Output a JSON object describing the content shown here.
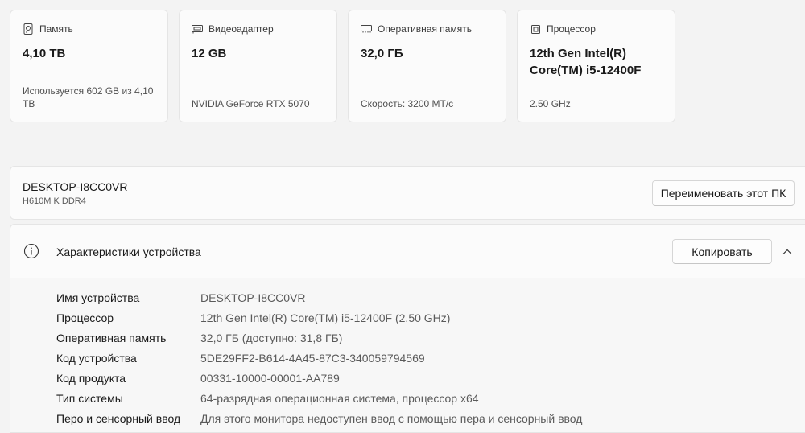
{
  "cards": [
    {
      "icon": "storage-icon",
      "title": "Память",
      "value": "4,10 ТВ",
      "sub": "Используется 602 GB из 4,10 ТВ"
    },
    {
      "icon": "gpu-icon",
      "title": "Видеоадаптер",
      "value": "12 GB",
      "sub": "NVIDIA GeForce RTX 5070"
    },
    {
      "icon": "ram-icon",
      "title": "Оперативная память",
      "value": "32,0 ГБ",
      "sub": "Скорость: 3200 МТ/с"
    },
    {
      "icon": "cpu-icon",
      "title": "Процессор",
      "value": "12th Gen Intel(R) Core(TM) i5-12400F",
      "sub": "2.50 GHz"
    }
  ],
  "pc": {
    "name": "DESKTOP-I8CC0VR",
    "model": "H610M K DDR4",
    "rename_label": "Переименовать этот ПК"
  },
  "specs": {
    "title": "Характеристики устройства",
    "copy_label": "Копировать",
    "rows": [
      {
        "label": "Имя устройства",
        "value": "DESKTOP-I8CC0VR"
      },
      {
        "label": "Процессор",
        "value": "12th Gen Intel(R) Core(TM) i5-12400F (2.50 GHz)"
      },
      {
        "label": "Оперативная память",
        "value": "32,0 ГБ (доступно: 31,8 ГБ)"
      },
      {
        "label": "Код устройства",
        "value": "5DE29FF2-B614-4A45-87C3-340059794569"
      },
      {
        "label": "Код продукта",
        "value": "00331-10000-00001-AA789"
      },
      {
        "label": "Тип системы",
        "value": "64-разрядная операционная система, процессор x64"
      },
      {
        "label": "Перо и сенсорный ввод",
        "value": "Для этого монитора недоступен ввод с помощью пера и сенсорный ввод"
      }
    ]
  }
}
